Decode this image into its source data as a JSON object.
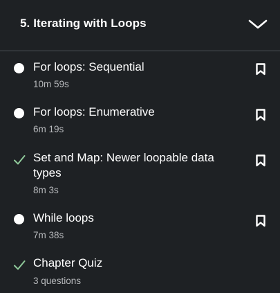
{
  "chapter": {
    "title": "5. Iterating with Loops",
    "toggle_icon": "chevron-down-icon"
  },
  "items": [
    {
      "title": "For loops: Sequential",
      "meta": "10m 59s",
      "status": "not-started",
      "status_icon": "dot-icon",
      "bookmark_icon": "bookmark-icon"
    },
    {
      "title": "For loops: Enumerative",
      "meta": "6m 19s",
      "status": "not-started",
      "status_icon": "dot-icon",
      "bookmark_icon": "bookmark-icon"
    },
    {
      "title": "Set and Map: Newer loopable data types",
      "meta": "8m 3s",
      "status": "completed",
      "status_icon": "checkmark-icon",
      "bookmark_icon": "bookmark-icon"
    },
    {
      "title": "While loops",
      "meta": "7m 38s",
      "status": "not-started",
      "status_icon": "dot-icon",
      "bookmark_icon": "bookmark-icon"
    },
    {
      "title": "Chapter Quiz",
      "meta": "3 questions",
      "status": "completed",
      "status_icon": "checkmark-icon"
    }
  ],
  "colors": {
    "background": "#1e2124",
    "divider": "#4d5157",
    "text": "#ffffff",
    "meta_text": "#b7b9bc",
    "check": "#8fc99a"
  }
}
